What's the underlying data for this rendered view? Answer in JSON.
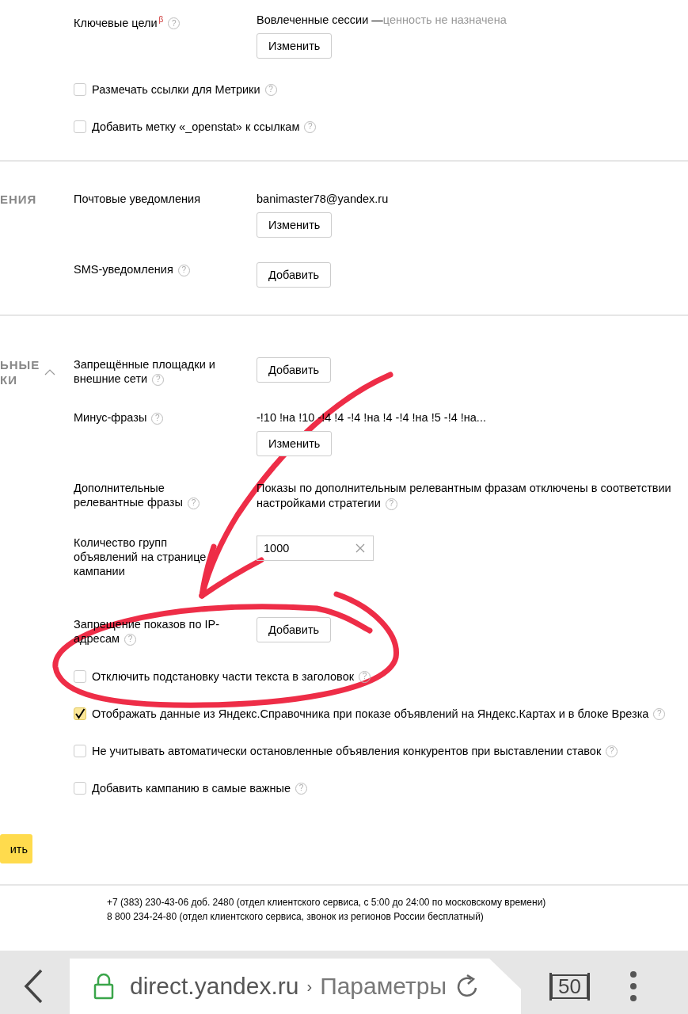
{
  "sections": [
    {
      "rows": [
        {
          "kind": "field",
          "label": "Ключевые цели",
          "beta": "β",
          "help": "?",
          "value": "Вовлеченные сессии —",
          "note": "ценность не назначена",
          "button": "Изменить"
        },
        {
          "kind": "checkbox",
          "label": "Размечать ссылки для Метрики",
          "help": "?",
          "checked": false
        },
        {
          "kind": "checkbox",
          "label": "Добавить метку «_openstat» к ссылкам",
          "help": "?",
          "checked": false
        }
      ]
    },
    {
      "heading": [
        "ЕНИЯ"
      ],
      "rows": [
        {
          "kind": "field",
          "label": "Почтовые уведомления",
          "value": "banimaster78@yandex.ru",
          "button": "Изменить"
        },
        {
          "kind": "field",
          "label": "SMS-уведомления",
          "help": "?",
          "button": "Добавить"
        }
      ]
    },
    {
      "heading": [
        "ЬНЫЕ",
        "КИ"
      ],
      "expanded": true,
      "rows": [
        {
          "kind": "field",
          "label": "Запрещённые площадки и внешние сети",
          "help": "?",
          "button": "Добавить"
        },
        {
          "kind": "field",
          "label": "Минус-фразы",
          "help": "?",
          "value": "-!10 !на !10 -!4 !4 -!4 !на !4 -!4 !на !5 -!4 !на...",
          "button": "Изменить"
        },
        {
          "kind": "field",
          "label": "Дополнительные релевантные фразы",
          "help": "?",
          "value_lines": [
            "Показы по дополнительным релевантным фразам отключены в соответствии",
            "настройками стратегии"
          ],
          "value_help": "?"
        },
        {
          "kind": "field",
          "label": "Количество групп объявлений на странице кампании",
          "input": "1000"
        },
        {
          "kind": "field",
          "label": "Запрещение показов по IP-адресам",
          "help": "?",
          "button": "Добавить"
        },
        {
          "kind": "checkbox",
          "label": "Отключить подстановку части текста в заголовок",
          "help": "?",
          "checked": false
        },
        {
          "kind": "checkbox",
          "label": "Отображать данные из Яндекс.Справочника при показе объявлений на Яндекс.Картах и в блоке Врезка",
          "help": "?",
          "checked": true
        },
        {
          "kind": "checkbox",
          "label": "Не учитывать автоматически остановленные объявления конкурентов при выставлении ставок",
          "help": "?",
          "checked": false
        },
        {
          "kind": "checkbox",
          "label": "Добавить кампанию в самые важные",
          "help": "?",
          "checked": false
        }
      ]
    }
  ],
  "save_button": "ить",
  "footer": [
    "+7 (383) 230-43-06 доб. 2480 (отдел клиентского сервиса, с 5:00 до 24:00 по московскому времени)",
    "8 800 234-24-80 (отдел клиентского сервиса, звонок из регионов России бесплатный)"
  ],
  "browser": {
    "domain": "direct.yandex.ru",
    "separator": "›",
    "page": "Параметры",
    "tabs": "50"
  }
}
